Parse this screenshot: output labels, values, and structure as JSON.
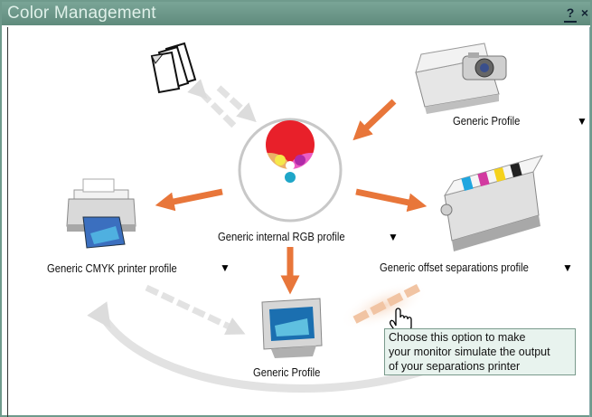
{
  "window": {
    "title": "Color Management",
    "help_label": "?",
    "close_label": "×"
  },
  "center": {
    "label": "Generic internal RGB profile"
  },
  "scanner": {
    "label": "Generic Profile"
  },
  "printer": {
    "label": "Generic CMYK printer profile"
  },
  "press": {
    "label": "Generic offset separations profile"
  },
  "monitor": {
    "label": "Generic Profile"
  },
  "tooltip": {
    "lines": [
      "Choose this option to make",
      "your monitor simulate the output",
      "of your separations printer"
    ]
  },
  "colors": {
    "arrow": "#e8763a",
    "title_bar": "#6f9a8c",
    "tooltip_bg": "#e8f3ee"
  }
}
